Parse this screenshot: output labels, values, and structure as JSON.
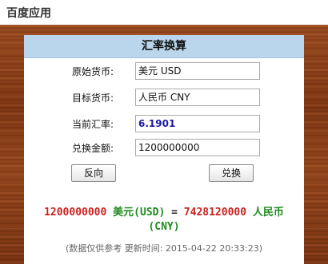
{
  "app": {
    "title": "百度应用"
  },
  "converter": {
    "title": "汇率换算",
    "rows": [
      {
        "label": "原始货币:",
        "value": "美元 USD"
      },
      {
        "label": "目标货币:",
        "value": "人民币 CNY"
      },
      {
        "label": "当前汇率:",
        "value": "6.1901"
      },
      {
        "label": "兑换金额:",
        "value": "1200000000"
      }
    ],
    "buttons": {
      "reverse": "反向",
      "convert": "兑换"
    },
    "result": {
      "amount": "1200000000",
      "from_currency": "美元(USD)",
      "equals": "=",
      "converted_amount": "7428120000",
      "to_currency_name": "人民币",
      "to_currency_code": "(CNY)"
    },
    "note": "(数据仅供参考 更新时间: 2015-04-22 20:33:23)"
  },
  "colors": {
    "header_bg": "#b9d6ec",
    "wood": "#8a3f18",
    "amount_red": "#cc1f1f",
    "currency_green": "#1e8a1e",
    "rate_blue": "#1a1aa0"
  }
}
